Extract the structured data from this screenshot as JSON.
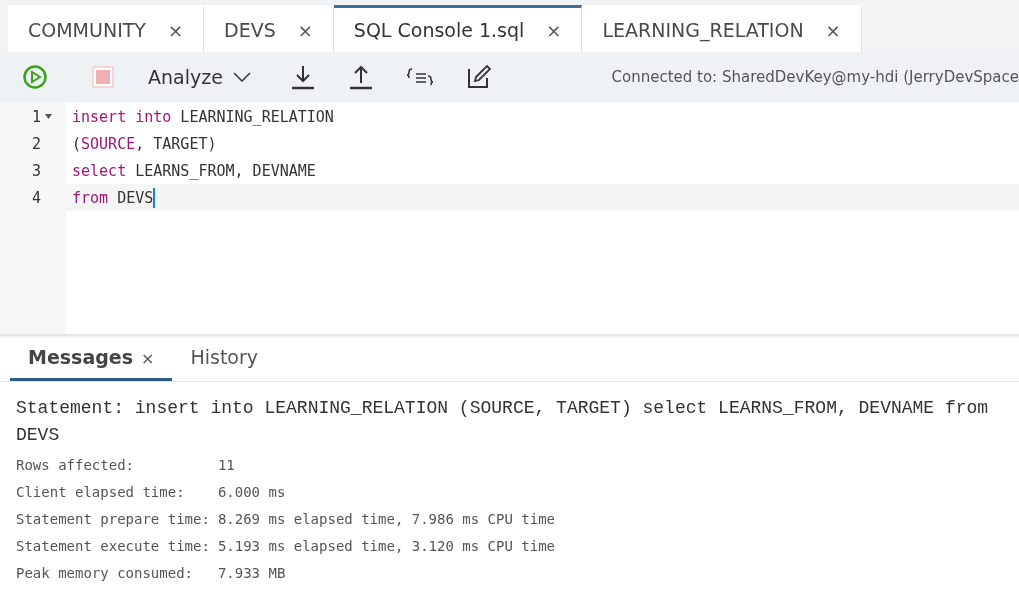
{
  "tabs": [
    {
      "label": "COMMUNITY",
      "close": "×",
      "selected": false
    },
    {
      "label": "DEVS",
      "close": "×",
      "selected": false
    },
    {
      "label": "SQL Console 1.sql",
      "close": "×",
      "selected": true
    },
    {
      "label": "LEARNING_RELATION",
      "close": "×",
      "selected": false
    }
  ],
  "toolbar": {
    "analyze": "Analyze",
    "connection": "Connected to: SharedDevKey@my-hdi (JerryDevSpace"
  },
  "editor": {
    "lines": [
      {
        "number": "1",
        "foldable": true,
        "cursor": false,
        "tokens": [
          {
            "text": "insert into",
            "kind": "keyword"
          },
          {
            "text": " LEARNING_RELATION",
            "kind": "plain"
          }
        ]
      },
      {
        "number": "2",
        "foldable": false,
        "cursor": false,
        "tokens": [
          {
            "text": "(",
            "kind": "plain"
          },
          {
            "text": "SOURCE",
            "kind": "keyword"
          },
          {
            "text": ", TARGET)",
            "kind": "plain"
          }
        ]
      },
      {
        "number": "3",
        "foldable": false,
        "cursor": false,
        "tokens": [
          {
            "text": "select",
            "kind": "keyword"
          },
          {
            "text": " LEARNS_FROM, DEVNAME",
            "kind": "plain"
          }
        ]
      },
      {
        "number": "4",
        "foldable": false,
        "cursor": true,
        "tokens": [
          {
            "text": "from",
            "kind": "keyword"
          },
          {
            "text": " DEVS",
            "kind": "plain"
          }
        ]
      }
    ]
  },
  "bottom_tabs": [
    {
      "label": "Messages",
      "selected": true,
      "close": "×"
    },
    {
      "label": "History",
      "selected": false
    }
  ],
  "messages": {
    "statement": "Statement: insert into LEARNING_RELATION (SOURCE, TARGET) select LEARNS_FROM, DEVNAME from DEVS",
    "details": [
      {
        "label": "Rows affected:",
        "value": "11"
      },
      {
        "label": "Client elapsed time:",
        "value": "6.000 ms"
      },
      {
        "label": "Statement prepare time:",
        "value": "8.269 ms elapsed time, 7.986 ms CPU time"
      },
      {
        "label": "Statement execute time:",
        "value": "5.193 ms elapsed time, 3.120 ms CPU time"
      },
      {
        "label": "Peak memory consumed:",
        "value": "7.933 MB"
      }
    ]
  }
}
